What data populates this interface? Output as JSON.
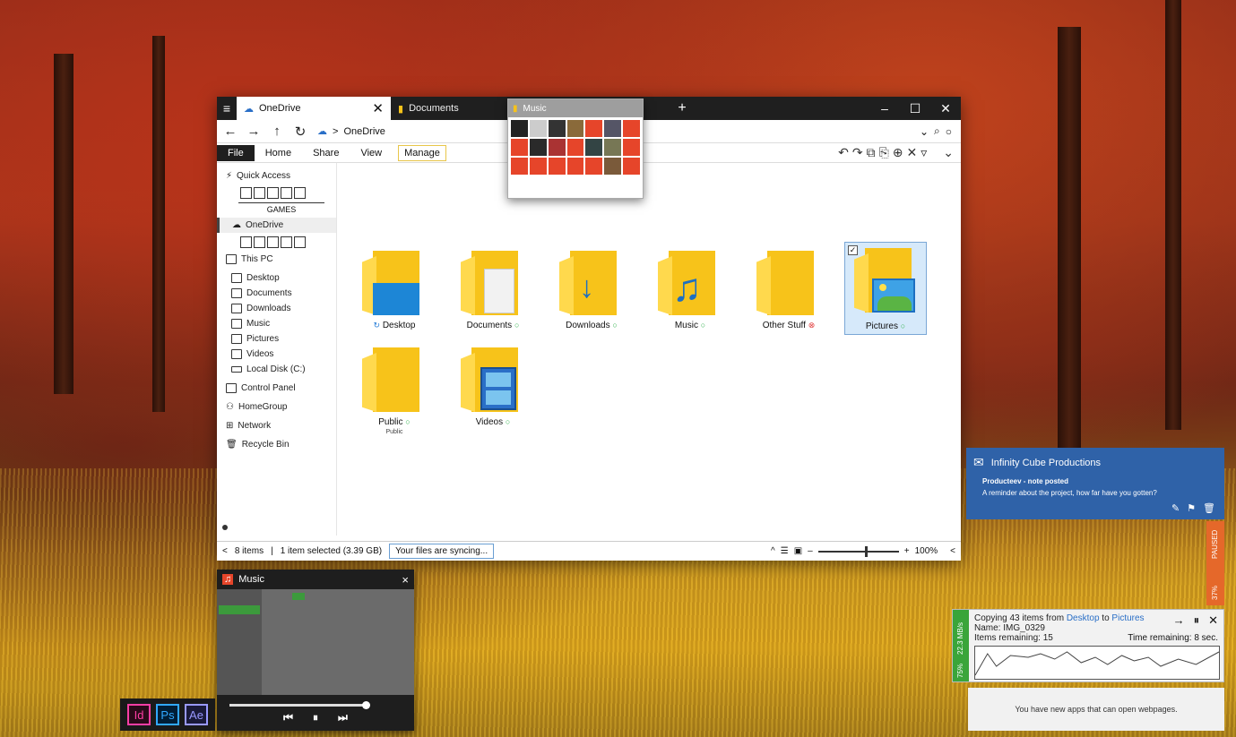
{
  "explorer": {
    "tabs": [
      {
        "label": "OneDrive",
        "active": true
      },
      {
        "label": "Documents",
        "active": false
      }
    ],
    "window_controls": {
      "min": "–",
      "max": "☐",
      "close": "✕"
    },
    "address": {
      "path": "OneDrive",
      "separator": ">"
    },
    "ribbon": {
      "tabs": [
        "File",
        "Home",
        "Share",
        "View"
      ],
      "manage": "Manage"
    },
    "sidebar": {
      "quick_access": "Quick Access",
      "games_label": "GAMES",
      "onedrive": "OneDrive",
      "this_pc": "This PC",
      "pc_items": [
        "Desktop",
        "Documents",
        "Downloads",
        "Music",
        "Pictures",
        "Videos",
        "Local Disk (C:)"
      ],
      "other_items": [
        "Control Panel",
        "HomeGroup",
        "Network",
        "Recycle Bin"
      ]
    },
    "folders": [
      {
        "label": "Desktop",
        "status": "syncing"
      },
      {
        "label": "Documents",
        "status": "ok"
      },
      {
        "label": "Downloads",
        "status": "ok"
      },
      {
        "label": "Music",
        "status": "ok"
      },
      {
        "label": "Other Stuff",
        "status": "error"
      },
      {
        "label": "Pictures",
        "status": "ok",
        "selected": true
      },
      {
        "label": "Public",
        "status": "ok",
        "sub": "Public"
      },
      {
        "label": "Videos",
        "status": "ok"
      }
    ],
    "statusbar": {
      "items": "8 items",
      "selected": "1 item selected (3.39 GB)",
      "sync": "Your files are syncing...",
      "zoom": "100%"
    }
  },
  "music_popup": {
    "title": "Music"
  },
  "player": {
    "title": "Music",
    "close": "×"
  },
  "adobe": [
    "Id",
    "Ps",
    "Ae"
  ],
  "notification": {
    "app": "Infinity Cube Productions",
    "title": "Producteev - note posted",
    "body": "A reminder about the project, how far have you gotten?"
  },
  "paused_panel": {
    "label": "PAUSED",
    "percent": "37%"
  },
  "copy": {
    "prefix": "Copying 43 items from ",
    "from": "Desktop",
    "mid": " to ",
    "to": "Pictures",
    "name": "Name: IMG_0329",
    "remaining": "Items remaining: 15",
    "time": "Time remaining: 8 sec.",
    "speed": "22.3 MB/s",
    "percent": "75%"
  },
  "web_notice": "You have new apps that can open webpages.",
  "colors": {
    "folder": "#f7c31a",
    "notification": "#2f62a8",
    "copy_green": "#3aa53a",
    "paused_orange": "#e5682a"
  }
}
